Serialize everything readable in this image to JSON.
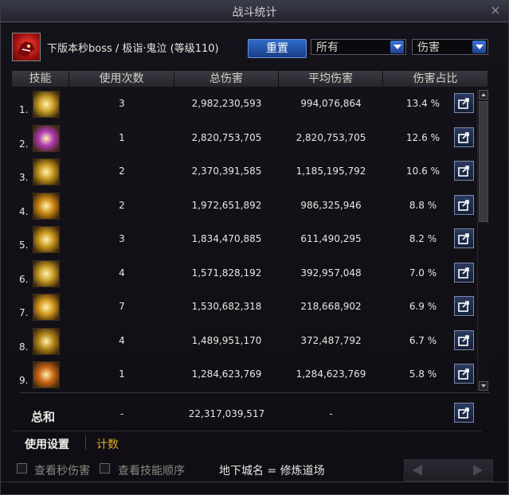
{
  "window": {
    "title": "战斗统计",
    "close_icon": "close-icon"
  },
  "header": {
    "boss_label": "下版本秒boss / 极诣·鬼泣 (等级110)",
    "reset_label": "重置",
    "filter1": "所有",
    "filter2": "伤害"
  },
  "table": {
    "columns": [
      "技能",
      "使用次数",
      "总伤害",
      "平均伤害",
      "伤害占比"
    ],
    "rows": [
      {
        "idx": "1.",
        "uses": "3",
        "total": "2,982,230,593",
        "avg": "994,076,864",
        "pct": "13.4 %",
        "color": "#caa22a"
      },
      {
        "idx": "2.",
        "uses": "1",
        "total": "2,820,753,705",
        "avg": "2,820,753,705",
        "pct": "12.6 %",
        "color": "#b23cb8"
      },
      {
        "idx": "3.",
        "uses": "2",
        "total": "2,370,391,585",
        "avg": "1,185,195,792",
        "pct": "10.6 %",
        "color": "#c99a22"
      },
      {
        "idx": "4.",
        "uses": "2",
        "total": "1,972,651,892",
        "avg": "986,325,946",
        "pct": "8.8 %",
        "color": "#d08a18"
      },
      {
        "idx": "5.",
        "uses": "3",
        "total": "1,834,470,885",
        "avg": "611,490,295",
        "pct": "8.2 %",
        "color": "#c8981c"
      },
      {
        "idx": "6.",
        "uses": "4",
        "total": "1,571,828,192",
        "avg": "392,957,048",
        "pct": "7.0 %",
        "color": "#c9a028"
      },
      {
        "idx": "7.",
        "uses": "7",
        "total": "1,530,682,318",
        "avg": "218,668,902",
        "pct": "6.9 %",
        "color": "#d49a20"
      },
      {
        "idx": "8.",
        "uses": "4",
        "total": "1,489,951,170",
        "avg": "372,487,792",
        "pct": "6.7 %",
        "color": "#b88a1c"
      },
      {
        "idx": "9.",
        "uses": "1",
        "total": "1,284,623,769",
        "avg": "1,284,623,769",
        "pct": "5.8 %",
        "color": "#d06a1a"
      }
    ]
  },
  "total": {
    "label": "总和",
    "uses": "-",
    "total": "22,317,039,517",
    "avg": "-"
  },
  "tabs": {
    "settings": "使用设置",
    "count": "计数"
  },
  "footer": {
    "cb1_label": "查看秒伤害",
    "cb2_label": "查看技能顺序",
    "dungeon": "地下城名 = 修炼道场"
  }
}
